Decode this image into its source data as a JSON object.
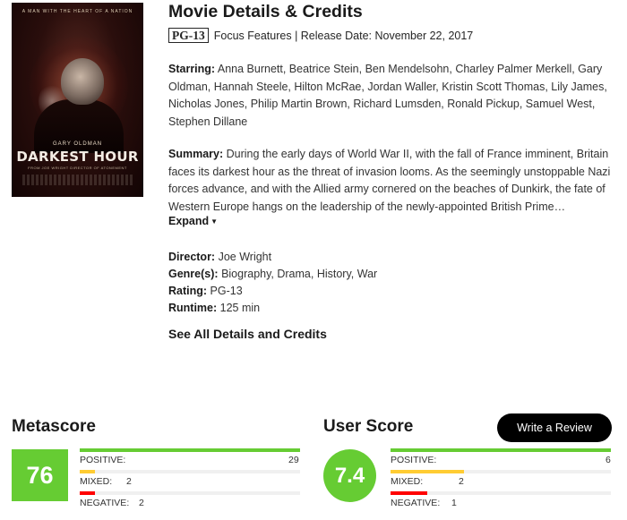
{
  "poster": {
    "tagline": "A MAN WITH THE HEART OF A NATION",
    "actor": "GARY OLDMAN",
    "title": "DARKEST HOUR",
    "credit": "FROM JOE WRIGHT DIRECTOR OF ATONEMENT"
  },
  "details": {
    "heading": "Movie Details & Credits",
    "rating_badge": "PG-13",
    "studio_release": "Focus Features | Release Date: November 22, 2017",
    "starring_label": "Starring:",
    "starring": "Anna Burnett, Beatrice Stein, Ben Mendelsohn, Charley Palmer Merkell, Gary Oldman, Hannah Steele, Hilton McRae, Jordan Waller, Kristin Scott Thomas, Lily James, Nicholas Jones, Philip Martin Brown, Richard Lumsden, Ronald Pickup, Samuel West, Stephen Dillane",
    "summary_label": "Summary:",
    "summary": "During the early days of World War II, with the fall of France imminent, Britain faces its darkest hour as the threat of invasion looms. As the seemingly unstoppable Nazi forces advance, and with the Allied army cornered on the beaches of Dunkirk, the fate of Western Europe hangs on the leadership of the newly-appointed British Prime…",
    "expand_label": "Expand",
    "director_label": "Director:",
    "director": "Joe Wright",
    "genres_label": "Genre(s):",
    "genres": "Biography, Drama, History, War",
    "rating_label": "Rating:",
    "rating": "PG-13",
    "runtime_label": "Runtime:",
    "runtime": "125 min",
    "all_details_label": "See All Details and Credits"
  },
  "metascore": {
    "heading": "Metascore",
    "score": "76",
    "rows": [
      {
        "label": "POSITIVE:",
        "count": "29",
        "fraction": 1.0,
        "color": "#66cc33"
      },
      {
        "label": "MIXED:",
        "count": "2",
        "fraction": 0.069,
        "color": "#ffcc33"
      },
      {
        "label": "NEGATIVE:",
        "count": "2",
        "fraction": 0.069,
        "color": "#ff0000"
      }
    ]
  },
  "userscore": {
    "heading": "User Score",
    "score": "7.4",
    "review_button": "Write a Review",
    "rows": [
      {
        "label": "POSITIVE:",
        "count": "6",
        "fraction": 1.0,
        "color": "#66cc33"
      },
      {
        "label": "MIXED:",
        "count": "2",
        "fraction": 0.333,
        "color": "#ffcc33"
      },
      {
        "label": "NEGATIVE:",
        "count": "1",
        "fraction": 0.167,
        "color": "#ff0000"
      }
    ]
  }
}
